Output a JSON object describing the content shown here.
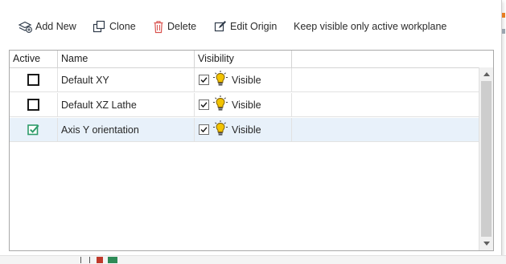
{
  "toolbar": {
    "add_new": "Add New",
    "clone": "Clone",
    "delete": "Delete",
    "edit_origin": "Edit Origin",
    "keep_visible": "Keep visible only active workplane"
  },
  "table": {
    "columns": [
      "Active",
      "Name",
      "Visibility",
      ""
    ],
    "rows": [
      {
        "active": false,
        "name": "Default XY",
        "visible_checked": true,
        "visibility": "Visible",
        "selected": false
      },
      {
        "active": false,
        "name": "Default XZ Lathe",
        "visible_checked": true,
        "visibility": "Visible",
        "selected": false
      },
      {
        "active": true,
        "name": "Axis Y orientation",
        "visible_checked": true,
        "visibility": "Visible",
        "selected": true
      }
    ]
  },
  "colors": {
    "selected_row": "#e8f1fa",
    "active_check": "#2e9b6a",
    "delete_icon": "#d9534f",
    "bulb": "#f2c300"
  }
}
